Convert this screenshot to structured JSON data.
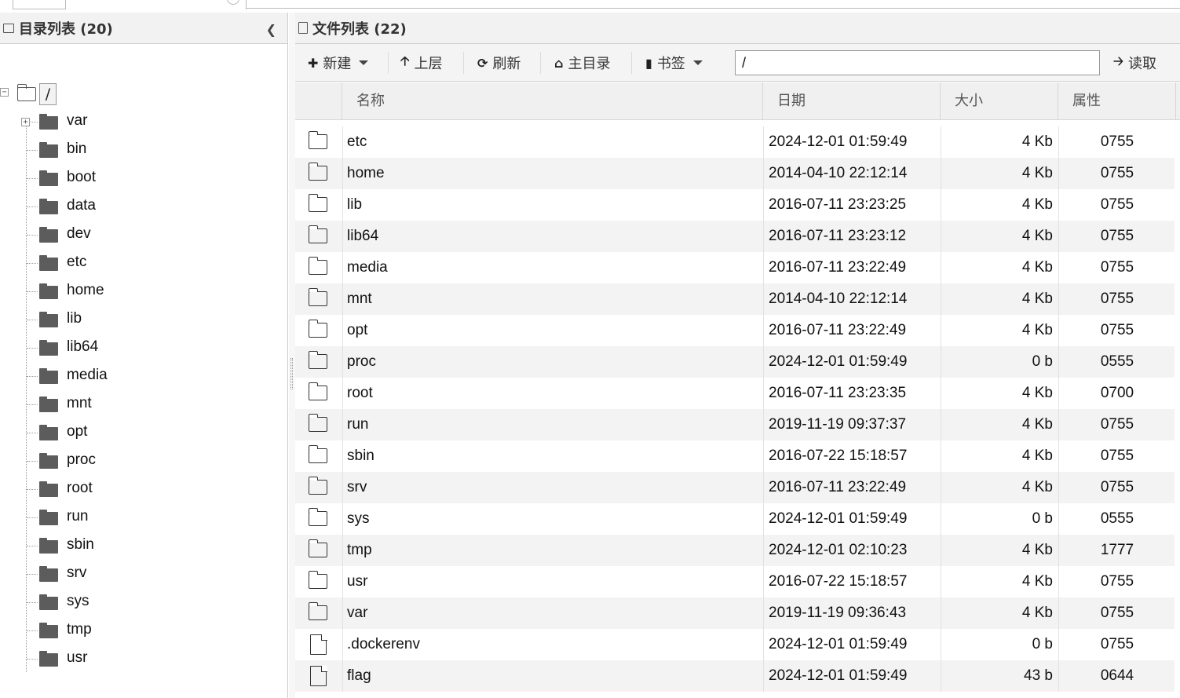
{
  "left_panel": {
    "title": "目录列表 (20)",
    "root": {
      "label": "/",
      "expander": "−"
    },
    "tree": [
      {
        "label": "var",
        "expandable": true
      },
      {
        "label": "bin"
      },
      {
        "label": "boot"
      },
      {
        "label": "data"
      },
      {
        "label": "dev"
      },
      {
        "label": "etc"
      },
      {
        "label": "home"
      },
      {
        "label": "lib"
      },
      {
        "label": "lib64"
      },
      {
        "label": "media"
      },
      {
        "label": "mnt"
      },
      {
        "label": "opt"
      },
      {
        "label": "proc"
      },
      {
        "label": "root"
      },
      {
        "label": "run"
      },
      {
        "label": "sbin"
      },
      {
        "label": "srv"
      },
      {
        "label": "sys"
      },
      {
        "label": "tmp"
      },
      {
        "label": "usr"
      }
    ]
  },
  "right_panel": {
    "title": "文件列表 (22)",
    "toolbar": {
      "new_label": "新建",
      "up_label": "上层",
      "refresh_label": "刷新",
      "home_label": "主目录",
      "bookmark_label": "书签",
      "path_value": "/",
      "read_label": "读取"
    },
    "columns": {
      "name": "名称",
      "date": "日期",
      "size": "大小",
      "attr": "属性"
    },
    "rows": [
      {
        "type": "folder",
        "name": "etc",
        "date": "2024-12-01 01:59:49",
        "size": "4 Kb",
        "attr": "0755"
      },
      {
        "type": "folder",
        "name": "home",
        "date": "2014-04-10 22:12:14",
        "size": "4 Kb",
        "attr": "0755"
      },
      {
        "type": "folder",
        "name": "lib",
        "date": "2016-07-11 23:23:25",
        "size": "4 Kb",
        "attr": "0755"
      },
      {
        "type": "folder",
        "name": "lib64",
        "date": "2016-07-11 23:23:12",
        "size": "4 Kb",
        "attr": "0755"
      },
      {
        "type": "folder",
        "name": "media",
        "date": "2016-07-11 23:22:49",
        "size": "4 Kb",
        "attr": "0755"
      },
      {
        "type": "folder",
        "name": "mnt",
        "date": "2014-04-10 22:12:14",
        "size": "4 Kb",
        "attr": "0755"
      },
      {
        "type": "folder",
        "name": "opt",
        "date": "2016-07-11 23:22:49",
        "size": "4 Kb",
        "attr": "0755"
      },
      {
        "type": "folder",
        "name": "proc",
        "date": "2024-12-01 01:59:49",
        "size": "0 b",
        "attr": "0555"
      },
      {
        "type": "folder",
        "name": "root",
        "date": "2016-07-11 23:23:35",
        "size": "4 Kb",
        "attr": "0700"
      },
      {
        "type": "folder",
        "name": "run",
        "date": "2019-11-19 09:37:37",
        "size": "4 Kb",
        "attr": "0755"
      },
      {
        "type": "folder",
        "name": "sbin",
        "date": "2016-07-22 15:18:57",
        "size": "4 Kb",
        "attr": "0755"
      },
      {
        "type": "folder",
        "name": "srv",
        "date": "2016-07-11 23:22:49",
        "size": "4 Kb",
        "attr": "0755"
      },
      {
        "type": "folder",
        "name": "sys",
        "date": "2024-12-01 01:59:49",
        "size": "0 b",
        "attr": "0555"
      },
      {
        "type": "folder",
        "name": "tmp",
        "date": "2024-12-01 02:10:23",
        "size": "4 Kb",
        "attr": "1777"
      },
      {
        "type": "folder",
        "name": "usr",
        "date": "2016-07-22 15:18:57",
        "size": "4 Kb",
        "attr": "0755"
      },
      {
        "type": "folder",
        "name": "var",
        "date": "2019-11-19 09:36:43",
        "size": "4 Kb",
        "attr": "0755"
      },
      {
        "type": "file",
        "name": ".dockerenv",
        "date": "2024-12-01 01:59:49",
        "size": "0 b",
        "attr": "0755"
      },
      {
        "type": "file",
        "name": "flag",
        "date": "2024-12-01 01:59:49",
        "size": "43 b",
        "attr": "0644"
      }
    ]
  },
  "icons": {
    "collapse": "chevron-left-icon",
    "new": "plus-circle-icon",
    "up": "arrow-up-icon",
    "refresh": "refresh-icon",
    "home": "home-icon",
    "bookmark": "bookmark-icon",
    "read": "arrow-right-icon"
  }
}
